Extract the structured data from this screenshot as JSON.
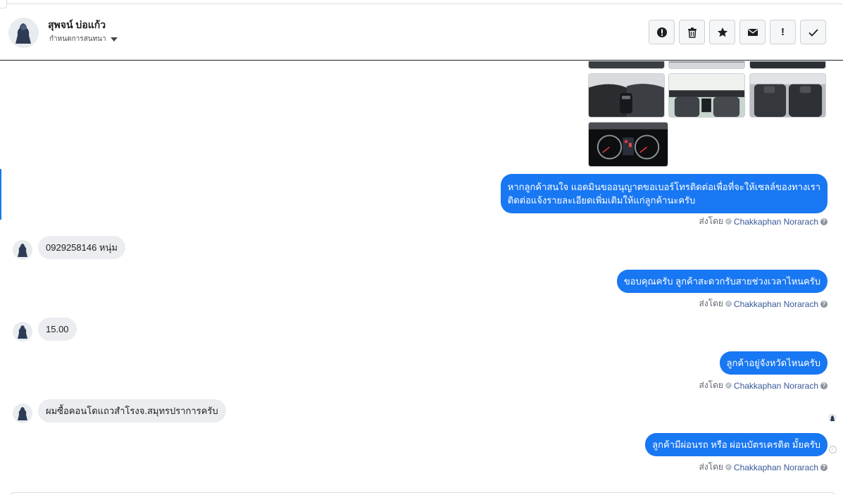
{
  "header": {
    "contact_name": "สุพจน์ บ่อแก้ว",
    "assign_label": "กำหนดการสนทนา",
    "toolbar": [
      {
        "name": "alert-button",
        "icon": "alert-circle-icon"
      },
      {
        "name": "delete-button",
        "icon": "trash-icon"
      },
      {
        "name": "star-button",
        "icon": "star-icon"
      },
      {
        "name": "mark-unread-button",
        "icon": "envelope-icon"
      },
      {
        "name": "important-button",
        "icon": "exclamation-icon",
        "label": "!"
      },
      {
        "name": "done-button",
        "icon": "checkmark-icon"
      }
    ]
  },
  "photos": [
    "car-interior-photo",
    "car-interior-photo",
    "car-interior-photo",
    "car-seats-photo",
    "car-cabin-photo",
    "car-rear-seats-photo",
    "car-gauge-cluster-photo"
  ],
  "messages": [
    {
      "direction": "out",
      "text_lines": [
        "หากลูกค้าสนใจ แอดมินขออนุญาตขอเบอร์โทรติดต่อเพื่อที่จะให้เซลล์ของทางเรา",
        "ติดต่อแจ้งรายละเอียดเพิ่มเติมให้แก่ลูกค้านะครับ"
      ],
      "sent_by_label": "ส่งโดย",
      "agent": "Chakkaphan Norarach"
    },
    {
      "direction": "in",
      "text": "0929258146 หนุ่ม"
    },
    {
      "direction": "out",
      "text": "ขอบคุณครับ ลูกค้าสะดวกรับสายช่วงเวลาไหนครับ",
      "sent_by_label": "ส่งโดย",
      "agent": "Chakkaphan Norarach"
    },
    {
      "direction": "in",
      "text": "15.00"
    },
    {
      "direction": "out",
      "text": "ลูกค้าอยู่จังหวัดไหนครับ",
      "sent_by_label": "ส่งโดย",
      "agent": "Chakkaphan Norarach"
    },
    {
      "direction": "in",
      "text": "ผมซื้อคอนโดแถวสำโรงจ.สมุทรปราการครับ"
    },
    {
      "direction": "out",
      "text": "ลูกค้ามีผ่อนรถ หรือ ผ่อนบัตรเครดิต มั้ยครับ",
      "sent_by_label": "ส่งโดย",
      "agent": "Chakkaphan Norarach"
    }
  ],
  "colors": {
    "accent": "#1877f2",
    "incoming_bubble": "#ebedf0",
    "agent_link": "#385898"
  }
}
